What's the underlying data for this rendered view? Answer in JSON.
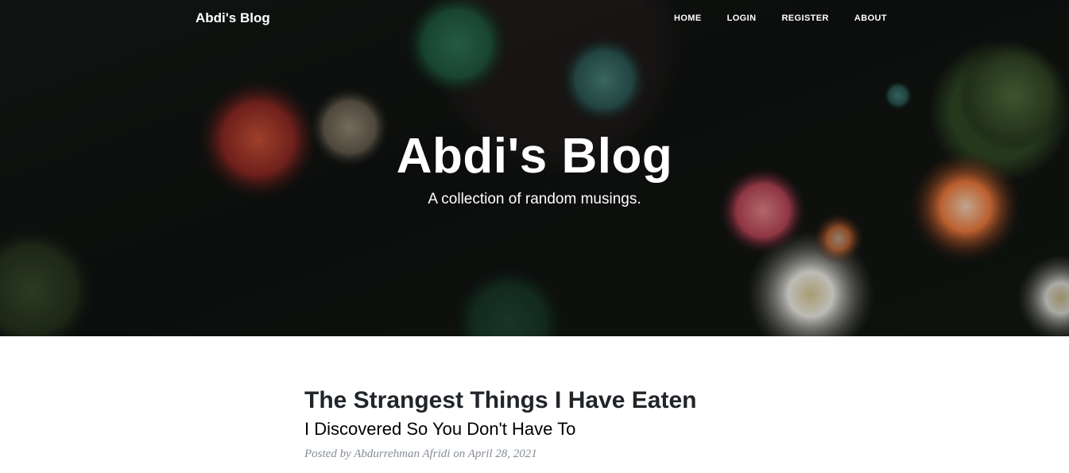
{
  "nav": {
    "brand": "Abdi's Blog",
    "links": [
      "HOME",
      "LOGIN",
      "REGISTER",
      "ABOUT"
    ]
  },
  "hero": {
    "title": "Abdi's Blog",
    "subtitle": "A collection of random musings."
  },
  "post": {
    "title": "The Strangest Things I Have Eaten",
    "subtitle": "I Discovered So You Don't Have To",
    "meta_prefix": "Posted by",
    "author": "Abdurrehman Afridi",
    "meta_on": "on",
    "date": "April 28, 2021"
  },
  "colors": {
    "text_dark": "#212529",
    "meta_gray": "#868e96"
  }
}
